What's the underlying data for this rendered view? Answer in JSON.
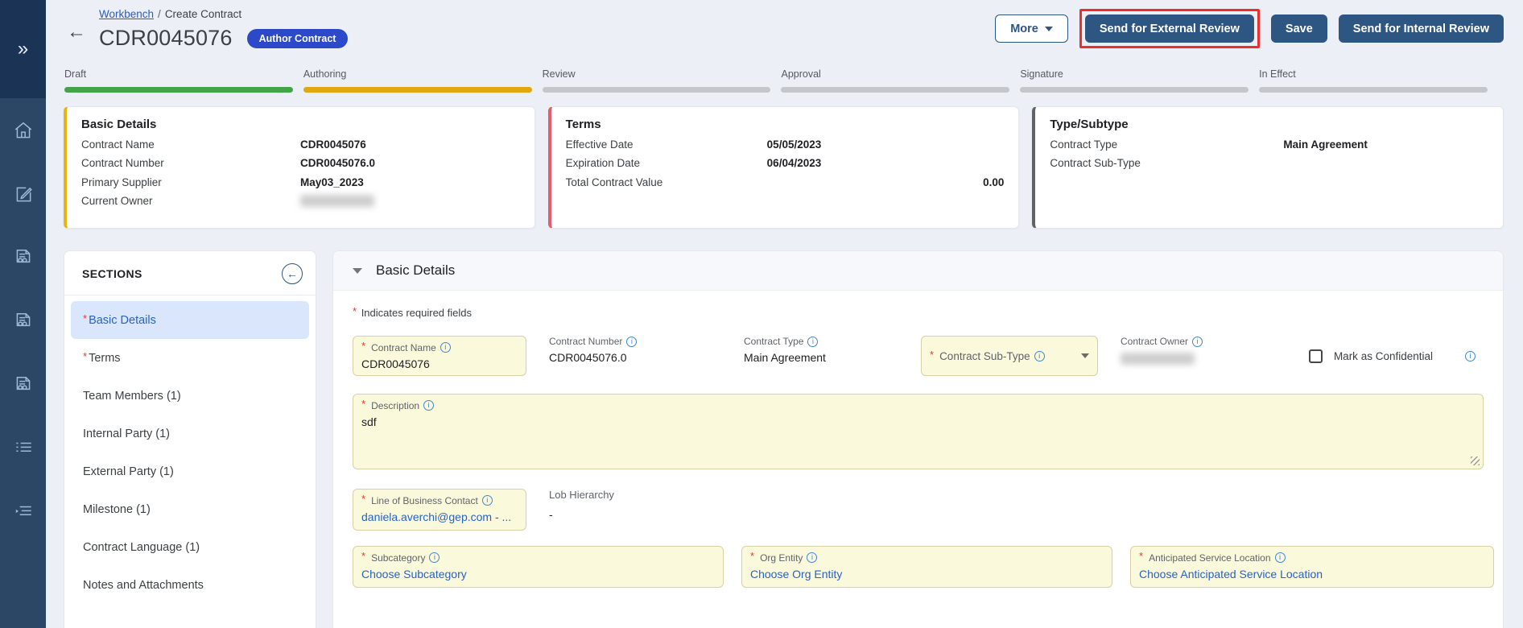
{
  "ui": {
    "required_marker": "*",
    "back_arrow": "←",
    "collapse_arrow": "←",
    "expand_glyph": "»",
    "info_glyph": "i"
  },
  "colors": {
    "accent_button": "#2d5683",
    "badge_blue": "#2b49c9",
    "stage_complete": "#44a248",
    "stage_current": "#e0a70e",
    "required_field_bg": "#fbf9dc",
    "annotation_red": "#ee2d2d",
    "link_blue": "#2563c9"
  },
  "sidebar": {
    "icons": [
      "expand-rail",
      "home",
      "compose",
      "contract-document",
      "contract-document",
      "contract-document",
      "list",
      "workflow-menu"
    ]
  },
  "header": {
    "breadcrumb": {
      "link": "Workbench",
      "separator": "/",
      "current": "Create Contract"
    },
    "title": "CDR0045076",
    "badge": "Author Contract",
    "buttons": {
      "more": "More",
      "send_external": "Send for External Review",
      "save": "Save",
      "send_internal": "Send for Internal Review"
    }
  },
  "progress": {
    "stages": [
      {
        "label": "Draft",
        "state": "complete"
      },
      {
        "label": "Authoring",
        "state": "current"
      },
      {
        "label": "Review",
        "state": "pending"
      },
      {
        "label": "Approval",
        "state": "pending"
      },
      {
        "label": "Signature",
        "state": "pending"
      },
      {
        "label": "In Effect",
        "state": "pending"
      }
    ]
  },
  "cards": {
    "basic_details": {
      "title": "Basic Details",
      "rows": [
        {
          "label": "Contract Name",
          "value": "CDR0045076"
        },
        {
          "label": "Contract Number",
          "value": "CDR0045076.0"
        },
        {
          "label": "Primary Supplier",
          "value": "May03_2023"
        },
        {
          "label": "Current Owner",
          "value": "",
          "redacted": true
        }
      ]
    },
    "terms": {
      "title": "Terms",
      "rows": [
        {
          "label": "Effective Date",
          "value": "05/05/2023"
        },
        {
          "label": "Expiration Date",
          "value": "06/04/2023"
        },
        {
          "label": "Total Contract Value",
          "value": "0.00",
          "align": "right"
        }
      ]
    },
    "type_subtype": {
      "title": "Type/Subtype",
      "rows": [
        {
          "label": "Contract Type",
          "value": "Main Agreement"
        },
        {
          "label": "Contract Sub-Type",
          "value": ""
        }
      ]
    }
  },
  "sections": {
    "title": "SECTIONS",
    "items": [
      {
        "label": "Basic Details",
        "required": true,
        "active": true
      },
      {
        "label": "Terms",
        "required": true
      },
      {
        "label": "Team Members (1)"
      },
      {
        "label": "Internal Party (1)"
      },
      {
        "label": "External Party (1)"
      },
      {
        "label": "Milestone (1)"
      },
      {
        "label": "Contract Language (1)"
      },
      {
        "label": "Notes and Attachments"
      }
    ]
  },
  "form": {
    "section_title": "Basic Details",
    "required_note": "Indicates required fields",
    "fields": {
      "contract_name": {
        "label": "Contract Name",
        "value": "CDR0045076"
      },
      "contract_number": {
        "label": "Contract Number",
        "value": "CDR0045076.0"
      },
      "contract_type": {
        "label": "Contract Type",
        "value": "Main Agreement"
      },
      "contract_sub_type": {
        "label": "Contract Sub-Type"
      },
      "contract_owner": {
        "label": "Contract Owner",
        "redacted": true
      },
      "mark_confidential": {
        "label": "Mark as Confidential",
        "checked": false
      },
      "description": {
        "label": "Description",
        "value": "sdf"
      },
      "lob_contact": {
        "label": "Line of Business Contact",
        "value": "daniela.averchi@gep.com - ..."
      },
      "lob_hierarchy": {
        "label": "Lob Hierarchy",
        "value": "-"
      },
      "subcategory": {
        "label": "Subcategory",
        "placeholder": "Choose Subcategory"
      },
      "org_entity": {
        "label": "Org Entity",
        "placeholder": "Choose Org Entity"
      },
      "anticipated_service_location": {
        "label": "Anticipated Service Location",
        "placeholder": "Choose Anticipated Service Location"
      }
    }
  }
}
